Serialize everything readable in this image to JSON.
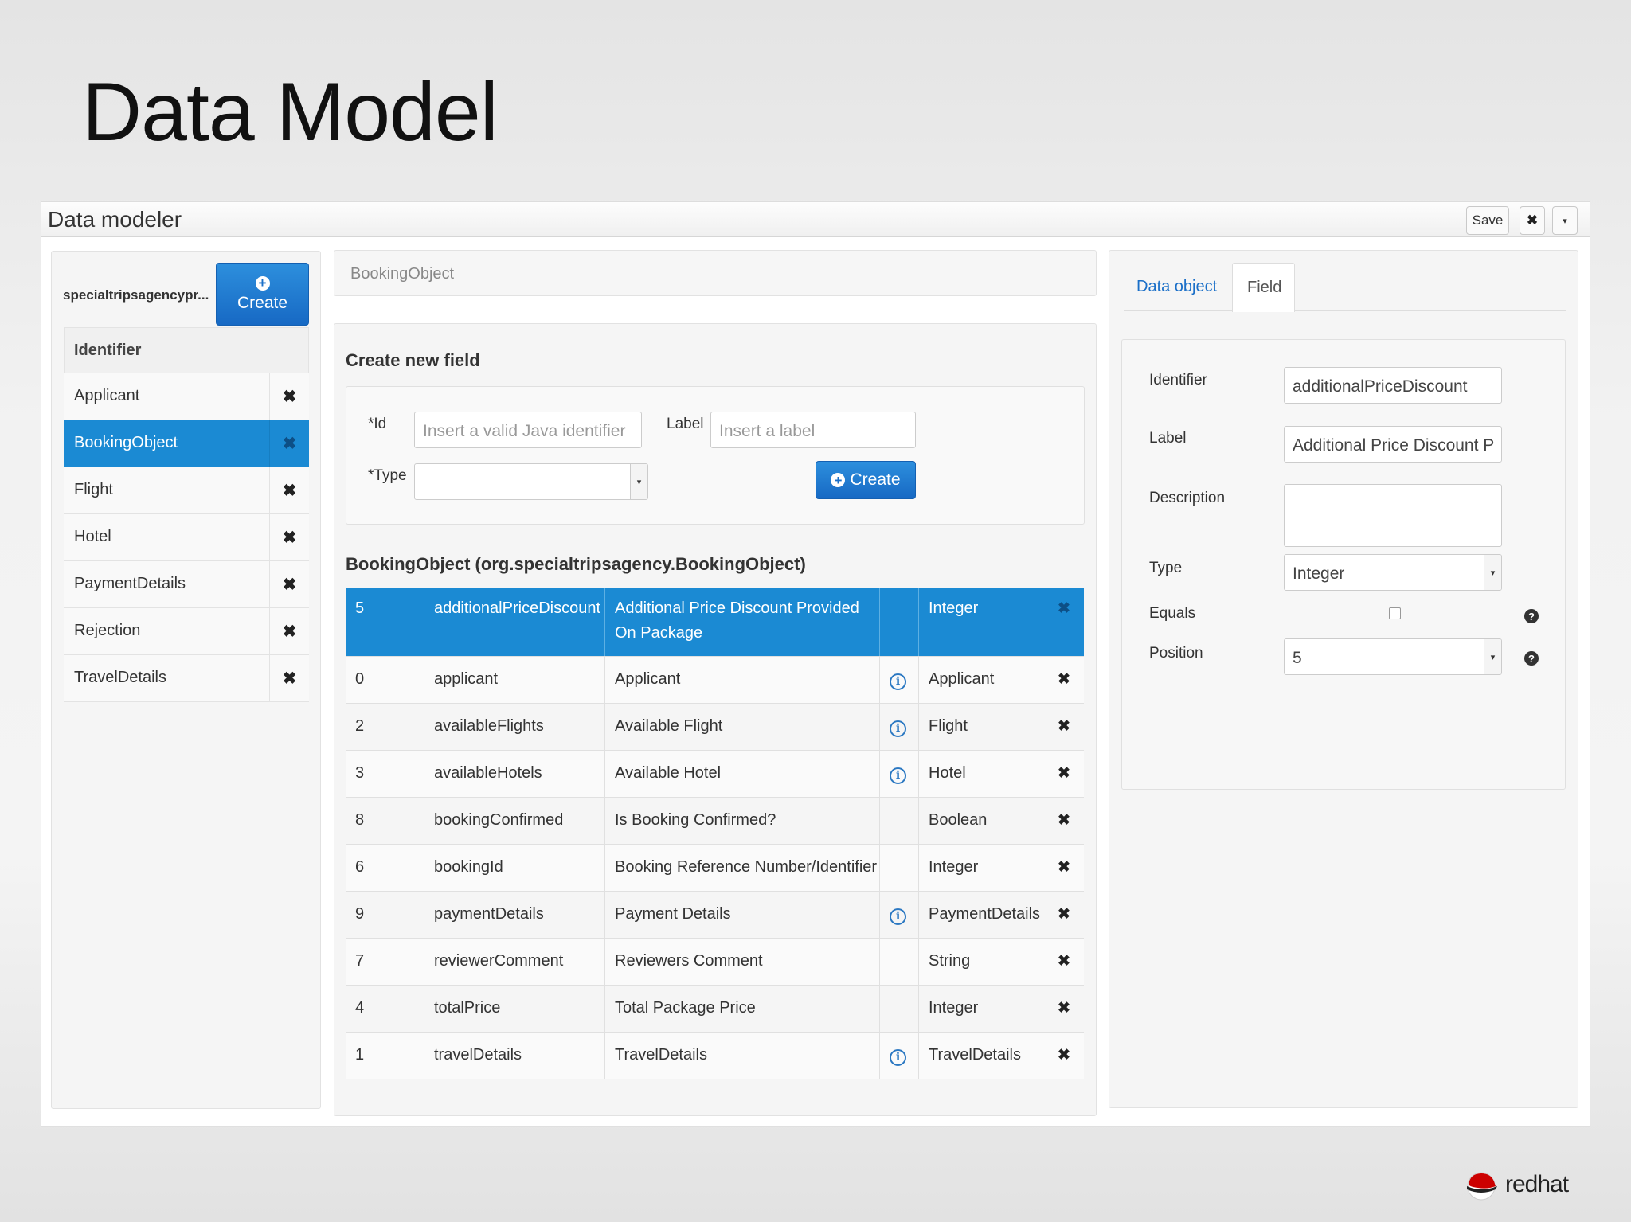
{
  "slide": {
    "title": "Data Model"
  },
  "app": {
    "title": "Data modeler",
    "save_label": "Save",
    "close_icon": "close-icon",
    "caret_icon": "caret-down-icon"
  },
  "left": {
    "project": "specialtripsagencypr...",
    "create_label": "Create",
    "header": "Identifier",
    "items": [
      {
        "label": "Applicant"
      },
      {
        "label": "BookingObject"
      },
      {
        "label": "Flight"
      },
      {
        "label": "Hotel"
      },
      {
        "label": "PaymentDetails"
      },
      {
        "label": "Rejection"
      },
      {
        "label": "TravelDetails"
      }
    ],
    "selected_index": 1
  },
  "center": {
    "breadcrumb": "BookingObject",
    "form_title": "Create new field",
    "id_label": "*Id",
    "id_placeholder": "Insert a valid Java identifier",
    "label_label": "Label",
    "label_placeholder": "Insert a label",
    "type_label": "*Type",
    "create_label": "Create",
    "table_title": "BookingObject (org.specialtripsagency.BookingObject)",
    "selected_row": {
      "pos": "5",
      "id": "additionalPriceDiscount",
      "label_line1": "Additional Price Discount Provided",
      "label_line2": "On Package",
      "type": "Integer"
    },
    "rows": [
      {
        "pos": "0",
        "id": "applicant",
        "label": "Applicant",
        "info": true,
        "type": "Applicant"
      },
      {
        "pos": "2",
        "id": "availableFlights",
        "label": "Available Flight",
        "info": true,
        "type": "Flight"
      },
      {
        "pos": "3",
        "id": "availableHotels",
        "label": "Available Hotel",
        "info": true,
        "type": "Hotel"
      },
      {
        "pos": "8",
        "id": "bookingConfirmed",
        "label": "Is Booking Confirmed?",
        "info": false,
        "type": "Boolean"
      },
      {
        "pos": "6",
        "id": "bookingId",
        "label": "Booking Reference Number/Identifier",
        "info": false,
        "type": "Integer"
      },
      {
        "pos": "9",
        "id": "paymentDetails",
        "label": "Payment Details",
        "info": true,
        "type": "PaymentDetails"
      },
      {
        "pos": "7",
        "id": "reviewerComment",
        "label": "Reviewers Comment",
        "info": false,
        "type": "String"
      },
      {
        "pos": "4",
        "id": "totalPrice",
        "label": "Total Package Price",
        "info": false,
        "type": "Integer"
      },
      {
        "pos": "1",
        "id": "travelDetails",
        "label": "TravelDetails",
        "info": true,
        "type": "TravelDetails"
      }
    ]
  },
  "right": {
    "tabs": [
      {
        "label": "Data object"
      },
      {
        "label": "Field"
      }
    ],
    "active_tab": "Field",
    "identifier_label": "Identifier",
    "identifier_value": "additionalPriceDiscount",
    "label_label": "Label",
    "label_value": "Additional Price Discount P",
    "description_label": "Description",
    "type_label": "Type",
    "type_value": "Integer",
    "equals_label": "Equals",
    "position_label": "Position",
    "position_value": "5"
  },
  "footer": {
    "brand": "redhat"
  },
  "colors": {
    "accent": "#1b8ad3",
    "brand_red": "#cc0000"
  }
}
